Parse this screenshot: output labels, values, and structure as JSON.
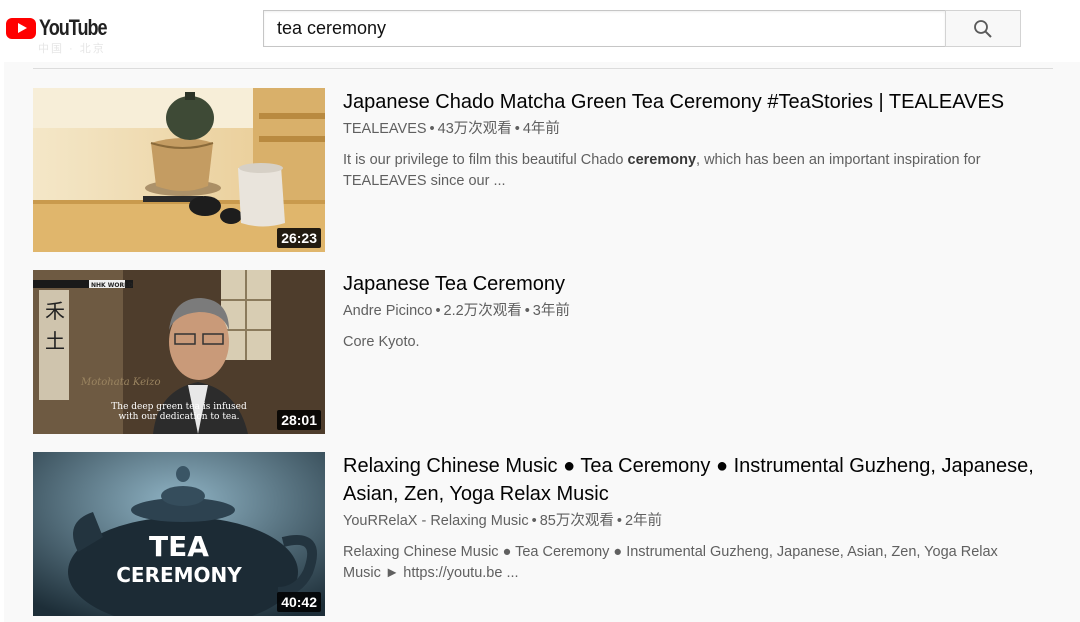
{
  "header": {
    "logo_text": "YouTube",
    "logo_sub": "中国 · 北京",
    "search": {
      "value": "tea ceremony"
    }
  },
  "results": [
    {
      "title": "Japanese Chado Matcha Green Tea Ceremony #TeaStories | TEALEAVES",
      "channel": "TEALEAVES",
      "views": "43万次观看",
      "age": "4年前",
      "desc_before": "It is our privilege to film this beautiful Chado ",
      "desc_bold": "ceremony",
      "desc_after": ", which has been an important inspiration for TEALEAVES since our ...",
      "duration": "26:23"
    },
    {
      "title": "Japanese Tea Ceremony",
      "channel": "Andre Picinco",
      "views": "2.2万次观看",
      "age": "3年前",
      "desc_before": "Core Kyoto.",
      "desc_bold": "",
      "desc_after": "",
      "duration": "28:01",
      "thumb_logo": "NHK WORLD",
      "thumb_name": "Motohata Keizo",
      "thumb_caption_1": "The deep green tea is infused",
      "thumb_caption_2": "with our dedication to tea."
    },
    {
      "title": "Relaxing Chinese Music ● Tea Ceremony ● Instrumental Guzheng, Japanese, Asian, Zen, Yoga Relax Music",
      "channel": "YouRRelaX - Relaxing Music",
      "views": "85万次观看",
      "age": "2年前",
      "desc_before": "Relaxing Chinese Music ● Tea Ceremony ● Instrumental Guzheng, Japanese, Asian, Zen, Yoga Relax Music ► https://youtu.be ...",
      "desc_bold": "",
      "desc_after": "",
      "duration": "40:42",
      "thumb_text_1": "TEA",
      "thumb_text_2": "CEREMONY"
    }
  ],
  "meta_separator": "•",
  "colors": {
    "brand": "#ff0000",
    "meta": "#606060"
  }
}
